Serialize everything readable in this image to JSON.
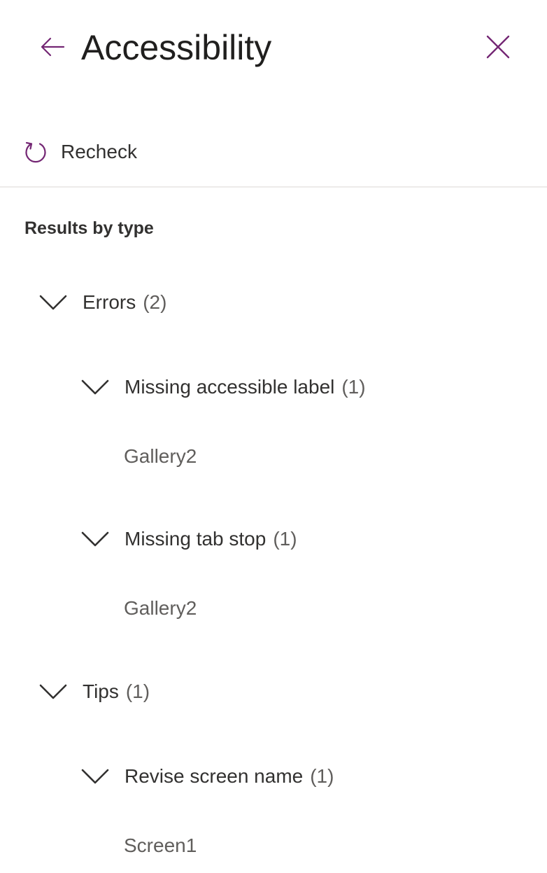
{
  "header": {
    "title": "Accessibility",
    "back_icon": "arrow-left-icon",
    "close_icon": "close-icon",
    "accent_color": "#742774"
  },
  "toolbar": {
    "recheck_label": "Recheck",
    "recheck_icon": "refresh-icon"
  },
  "results": {
    "heading": "Results by type",
    "groups": [
      {
        "label": "Errors",
        "count": "(2)",
        "issues": [
          {
            "label": "Missing accessible label",
            "count": "(1)",
            "items": [
              "Gallery2"
            ]
          },
          {
            "label": "Missing tab stop",
            "count": "(1)",
            "items": [
              "Gallery2"
            ]
          }
        ]
      },
      {
        "label": "Tips",
        "count": "(1)",
        "issues": [
          {
            "label": "Revise screen name",
            "count": "(1)",
            "items": [
              "Screen1"
            ]
          }
        ]
      }
    ]
  }
}
